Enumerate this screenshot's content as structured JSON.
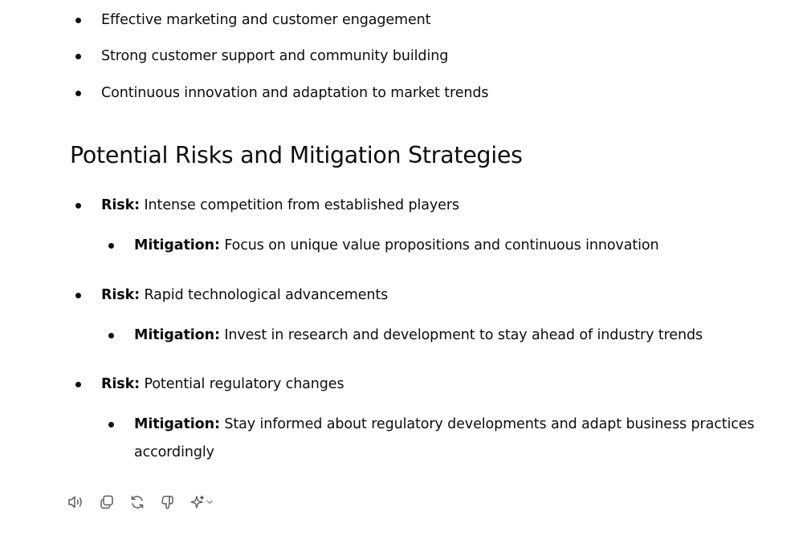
{
  "intro_bullets": [
    "Effective marketing and customer engagement",
    "Strong customer support and community building",
    "Continuous innovation and adaptation to market trends"
  ],
  "section_title": "Potential Risks and Mitigation Strategies",
  "risks": [
    {
      "risk_label": "Risk:",
      "risk_text": "Intense competition from established players",
      "mitigation_label": "Mitigation:",
      "mitigation_text": "Focus on unique value propositions and continuous innovation"
    },
    {
      "risk_label": "Risk:",
      "risk_text": "Rapid technological advancements",
      "mitigation_label": "Mitigation:",
      "mitigation_text": "Invest in research and development to stay ahead of industry trends"
    },
    {
      "risk_label": "Risk:",
      "risk_text": "Potential regulatory changes",
      "mitigation_label": "Mitigation:",
      "mitigation_text": "Stay informed about regulatory developments and adapt business practices accordingly"
    }
  ],
  "action_icons": [
    "speaker-icon",
    "copy-icon",
    "regenerate-icon",
    "thumbs-down-icon",
    "sparkle-icon",
    "chevron-down-icon"
  ]
}
